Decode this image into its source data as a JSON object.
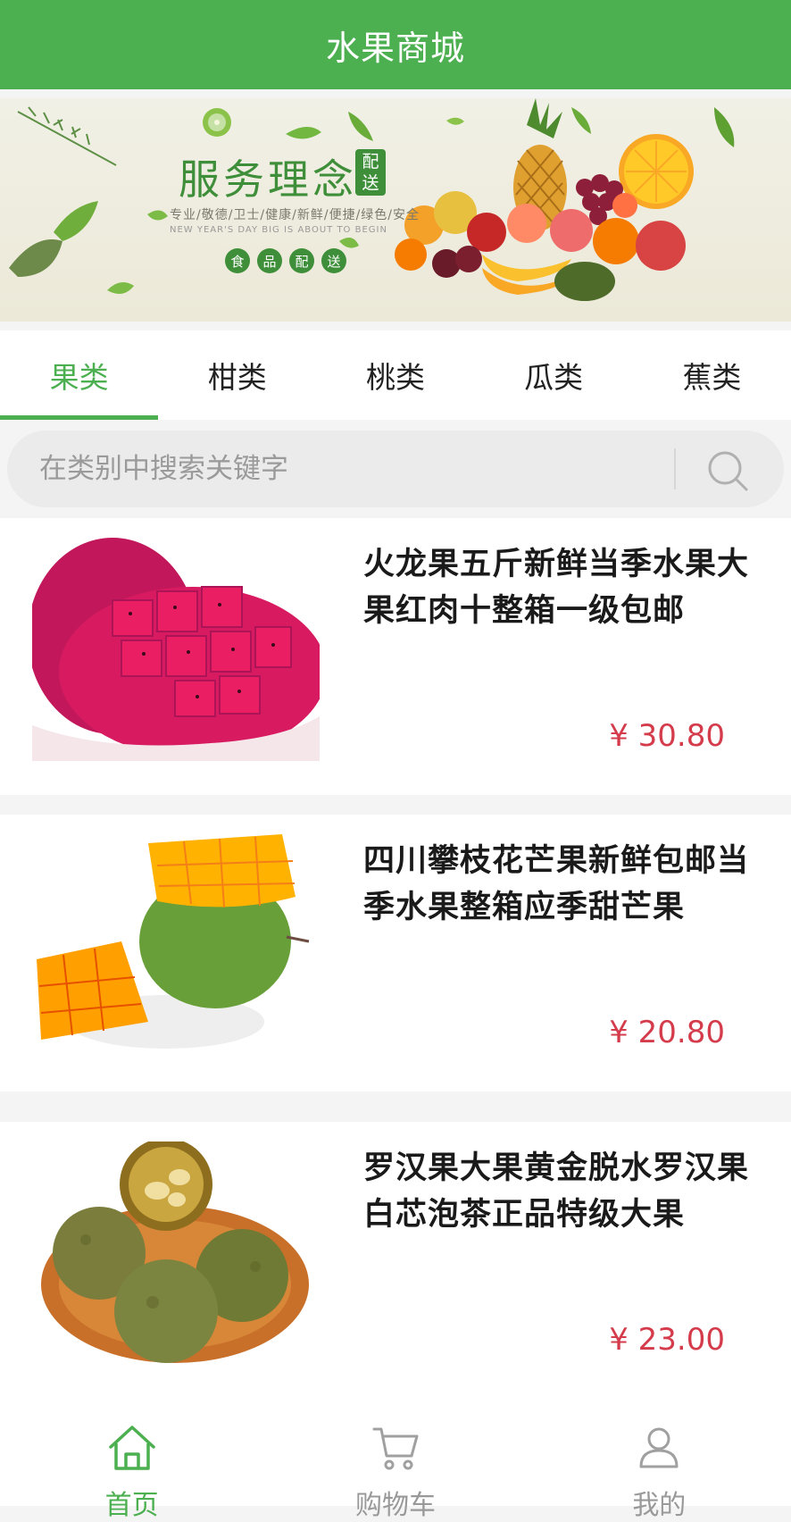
{
  "app": {
    "title": "水果商城",
    "accent_color": "#4caf50",
    "price_color": "#d43c4c"
  },
  "banner": {
    "title": "服务理念",
    "badge": "配送",
    "subtitle": "专业/敬德/卫士/健康/新鲜/便捷/绿色/安全",
    "english": "NEW YEAR'S DAY BIG IS ABOUT TO BEGIN",
    "service_chars": [
      "食",
      "品",
      "配",
      "送"
    ]
  },
  "tabs": [
    {
      "label": "果类",
      "active": true
    },
    {
      "label": "柑类",
      "active": false
    },
    {
      "label": "桃类",
      "active": false
    },
    {
      "label": "瓜类",
      "active": false
    },
    {
      "label": "蕉类",
      "active": false
    }
  ],
  "search": {
    "placeholder": "在类别中搜索关键字",
    "icon": "search-icon"
  },
  "products": [
    {
      "name": "火龙果五斤新鲜当季水果大果红肉十整箱一级包邮",
      "price": "¥ 30.80",
      "image": "dragon-fruit"
    },
    {
      "name": "四川攀枝花芒果新鲜包邮当季水果整箱应季甜芒果",
      "price": "¥ 20.80",
      "image": "mango"
    },
    {
      "name": "罗汉果大果黄金脱水罗汉果白芯泡茶正品特级大果",
      "price": "¥ 23.00",
      "image": "monk-fruit"
    }
  ],
  "bottom_nav": [
    {
      "label": "首页",
      "icon": "home-icon",
      "active": true
    },
    {
      "label": "购物车",
      "icon": "cart-icon",
      "active": false
    },
    {
      "label": "我的",
      "icon": "user-icon",
      "active": false
    }
  ]
}
